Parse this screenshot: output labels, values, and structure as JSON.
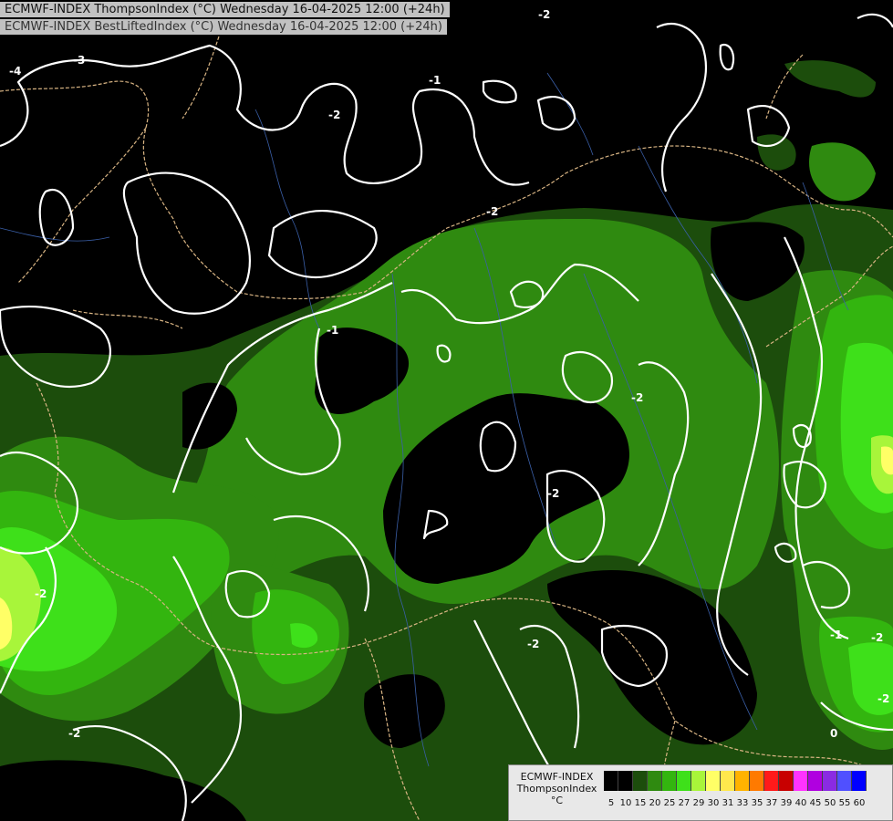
{
  "header": {
    "line1": "ECMWF-INDEX ThompsonIndex (°C) Wednesday 16-04-2025 12:00 (+24h)",
    "line2": "ECMWF-INDEX BestLiftedIndex (°C) Wednesday 16-04-2025 12:00 (+24h)"
  },
  "legend": {
    "title_line1": "ECMWF-INDEX",
    "title_line2": "ThompsonIndex",
    "title_line3": "°C",
    "colors": [
      "#000000",
      "#000000",
      "#000000",
      "#000000",
      "#1c4d0c",
      "#2f8a10",
      "#33b50f",
      "#3ee01a",
      "#a8f53a",
      "#ffff66",
      "#ffe84d",
      "#ffb300",
      "#ff7a00",
      "#ff1a1a",
      "#c80000",
      "#ff33ff",
      "#b000e0",
      "#8a2be2",
      "#5050ff",
      "#0000ff"
    ],
    "ticks": [
      "5",
      "10",
      "15",
      "20",
      "25",
      "27",
      "29",
      "30",
      "31",
      "33",
      "35",
      "37",
      "39",
      "40",
      "45",
      "50",
      "55",
      "60"
    ]
  },
  "contour_labels": [
    "-4",
    "-3",
    "-2",
    "-1",
    "-2",
    "-2",
    "-1",
    "-2",
    "-2",
    "-2",
    "-2",
    "-2",
    "-1",
    "-2",
    "-2",
    "0"
  ]
}
